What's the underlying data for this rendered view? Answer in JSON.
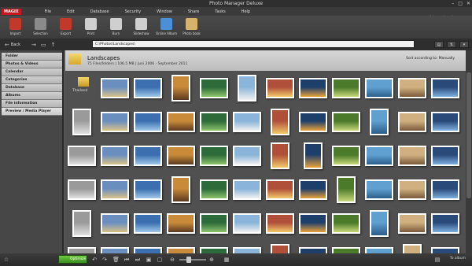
{
  "window": {
    "title": "Photo Manager Deluxe",
    "controls": [
      "–",
      "□",
      "✕"
    ]
  },
  "menu": {
    "logo": "MAGIX",
    "items": [
      "File",
      "Edit",
      "Database",
      "Security",
      "Window",
      "Share",
      "Tasks",
      "Help"
    ],
    "advanced_mode": "Advanced mode"
  },
  "toolbar": {
    "items": [
      {
        "label": "Import",
        "icon": "import-icon",
        "color": "#c0392b"
      },
      {
        "label": "Selection",
        "icon": "selection-icon",
        "color": "#8a8a8a"
      },
      {
        "label": "Export",
        "icon": "export-icon",
        "color": "#c0392b"
      },
      {
        "label": "Print",
        "icon": "print-icon",
        "color": "#cfcfcf"
      },
      {
        "label": "Burn",
        "icon": "burn-icon",
        "color": "#cfcfcf"
      },
      {
        "label": "Slideshow",
        "icon": "slideshow-icon",
        "color": "#cfcfcf"
      },
      {
        "label": "Online Album",
        "icon": "online-album-icon",
        "color": "#4b8fd6"
      },
      {
        "label": "Photo book",
        "icon": "photo-book-icon",
        "color": "#d7b36a"
      }
    ]
  },
  "nav": {
    "back_label": "Back",
    "path": "C:\\Photos\\Landscapes\\"
  },
  "sidebar": {
    "items": [
      "Folder",
      "Photos & Videos",
      "Calendar",
      "Categories",
      "Database",
      "Albums",
      "File information",
      "Preview / Media Player"
    ]
  },
  "album": {
    "title": "Landscapes",
    "info": "75 Files/folders | 106.5 MB | Juni 2006 - September 2011",
    "sort": "Sort according to: Manually",
    "subfolder": "Thailand"
  },
  "colors": {
    "accent": "#c8171e",
    "optimize": "#4fae2a"
  },
  "status": {
    "optimize_label": "Optimize",
    "to_album_label": "To album"
  }
}
